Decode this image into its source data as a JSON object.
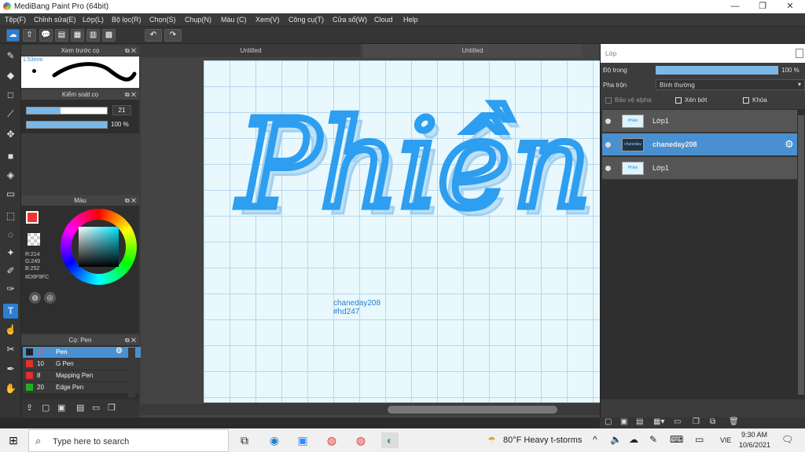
{
  "window": {
    "title": "MediBang Paint Pro (64bit)",
    "minimize": "—",
    "maximize": "❐",
    "close": "✕"
  },
  "menu": [
    "Tệp(F)",
    "Chỉnh sửa(E)",
    "Lớp(L)",
    "Bộ lọc(R)",
    "Chọn(S)",
    "Chụp(N)",
    "Màu (C)",
    "Xem(V)",
    "Công cụ(T)",
    "Cửa sổ(W)",
    "Cloud",
    "Help"
  ],
  "doc_tabs": [
    "Untitled",
    "Untitled"
  ],
  "preview_panel": {
    "title": "Xem trước cọ",
    "size": "1.53mm"
  },
  "brush_control": {
    "title": "Kiểm soát cọ",
    "size_value": "21",
    "opacity_value": "100 %",
    "size_fraction": 0.42,
    "opacity_fraction": 1.0
  },
  "color_panel": {
    "title": "Màu",
    "r": "R:214",
    "g": "G:249",
    "b": "B:252",
    "hex": "#D6F9FC"
  },
  "brush_list": {
    "title": "Cọ: Pen",
    "items": [
      {
        "size": "21",
        "name": "Pen",
        "color": "#222222",
        "selected": true
      },
      {
        "size": "10",
        "name": "G Pen",
        "color": "#e03030",
        "selected": false
      },
      {
        "size": "8",
        "name": "Mapping Pen",
        "color": "#e03030",
        "selected": false
      },
      {
        "size": "20",
        "name": "Edge Pen",
        "color": "#20b020",
        "selected": false
      }
    ]
  },
  "canvas": {
    "artwork_text": "Phiền",
    "watermark_line1": "chaneday208",
    "watermark_line2": "#hd247"
  },
  "layer_panel": {
    "title": "Lớp",
    "opacity_label": "Độ trong",
    "opacity_value": "100 %",
    "opacity_fraction": 1.0,
    "blend_label": "Pha trộn",
    "blend_value": "Bình thường",
    "protect_alpha": "Bảo vệ alpha",
    "clipping": "Xén bớt",
    "lock": "Khóa",
    "layers": [
      {
        "name": "Lớp1",
        "selected": false
      },
      {
        "name": "chaneday208",
        "selected": true
      },
      {
        "name": "Lớp1",
        "selected": false
      }
    ]
  },
  "taskbar": {
    "search_placeholder": "Type here to search",
    "weather": "80°F  Heavy t-storms",
    "lang": "VIE",
    "time": "9:30 AM",
    "date": "10/6/2021"
  }
}
